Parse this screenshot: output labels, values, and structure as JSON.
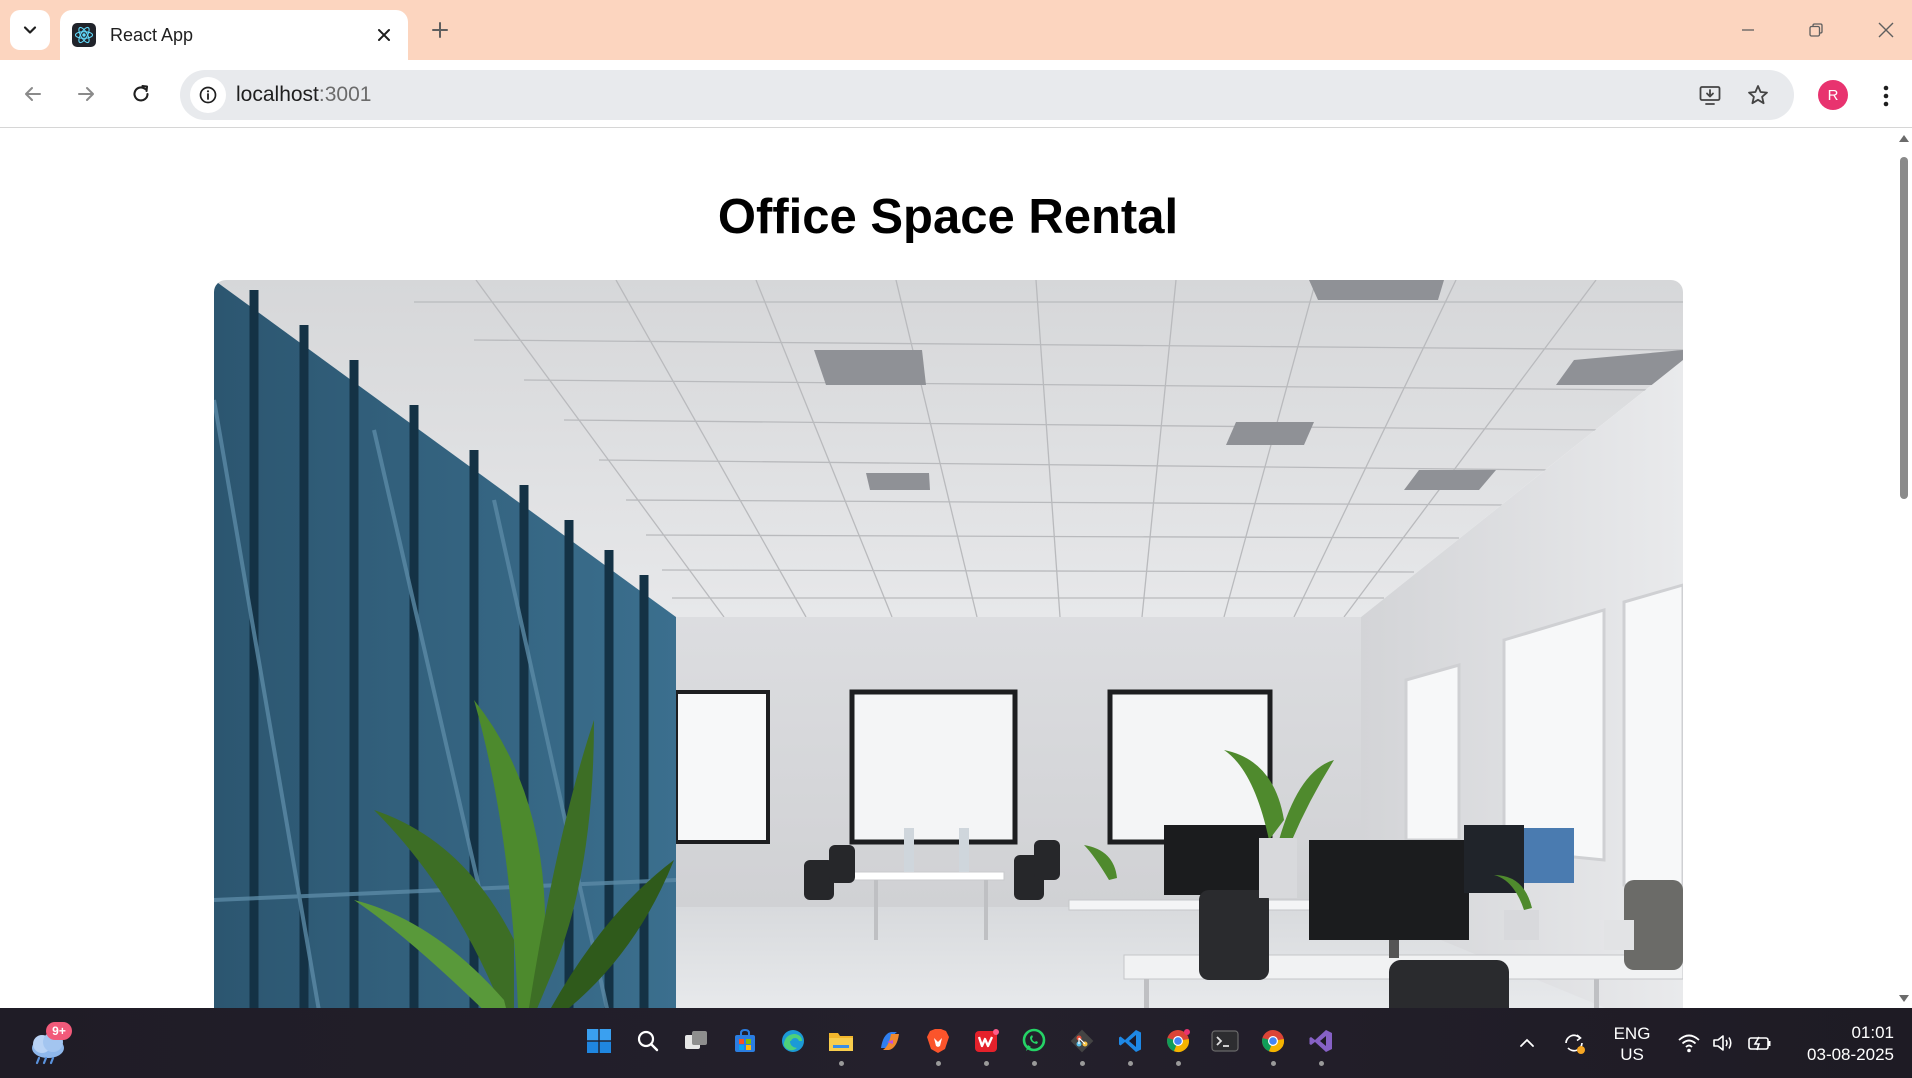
{
  "browser": {
    "tab": {
      "title": "React App",
      "favicon": "react-logo-icon"
    },
    "url": {
      "host": "localhost",
      "port": ":3001"
    },
    "profile_initial": "R",
    "accent_colors": {
      "tabstrip": "#fcd5bf",
      "profile": "#e8336f"
    }
  },
  "page": {
    "title": "Office Space Rental",
    "image": "office-interior-photo"
  },
  "taskbar": {
    "weather_badge": "9+",
    "pinned_apps": [
      "start-icon",
      "search-icon",
      "task-view-icon",
      "store-icon",
      "edge-icon",
      "file-explorer-icon",
      "copilot-icon",
      "brave-icon",
      "wps-icon",
      "whatsapp-icon",
      "git-icon",
      "vscode-icon",
      "chrome-icon",
      "terminal-icon",
      "chrome-icon",
      "visual-studio-icon"
    ],
    "language": {
      "line1": "ENG",
      "line2": "US"
    },
    "clock": {
      "time": "01:01",
      "date": "03-08-2025"
    }
  }
}
